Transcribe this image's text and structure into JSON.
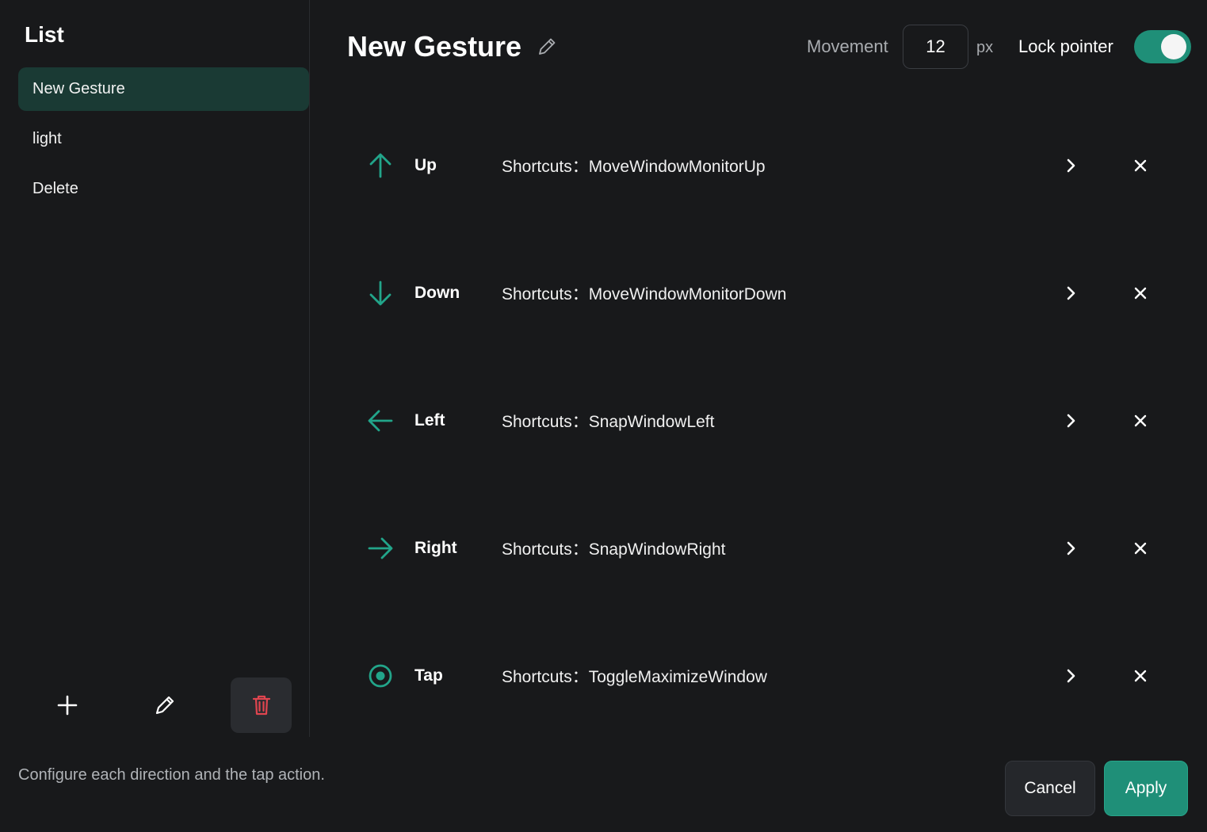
{
  "sidebar": {
    "title": "List",
    "items": [
      {
        "label": "New Gesture",
        "active": true
      },
      {
        "label": "light",
        "active": false
      },
      {
        "label": "Delete",
        "active": false
      }
    ],
    "actions": {
      "add_icon": "plus-icon",
      "edit_icon": "pencil-icon",
      "delete_icon": "trash-icon"
    }
  },
  "header": {
    "title": "New Gesture",
    "edit_icon": "pencil-icon",
    "movement_label": "Movement",
    "movement_value": "12",
    "unit": "px",
    "lock_label": "Lock pointer",
    "lock_enabled": true
  },
  "gestures": [
    {
      "icon": "arrow-up-icon",
      "name": "Up",
      "action": "Shortcuts：MoveWindowMonitorUp"
    },
    {
      "icon": "arrow-down-icon",
      "name": "Down",
      "action": "Shortcuts：MoveWindowMonitorDown"
    },
    {
      "icon": "arrow-left-icon",
      "name": "Left",
      "action": "Shortcuts：SnapWindowLeft"
    },
    {
      "icon": "arrow-right-icon",
      "name": "Right",
      "action": "Shortcuts：SnapWindowRight"
    },
    {
      "icon": "target-icon",
      "name": "Tap",
      "action": "Shortcuts：ToggleMaximizeWindow"
    }
  ],
  "footer": {
    "hint": "Configure each direction and the tap action.",
    "cancel_label": "Cancel",
    "apply_label": "Apply"
  },
  "colors": {
    "accent": "#1f8f78",
    "icon_accent": "#22a58a",
    "background": "#18191b",
    "active_item": "#1a3a34",
    "danger": "#e0454f"
  }
}
